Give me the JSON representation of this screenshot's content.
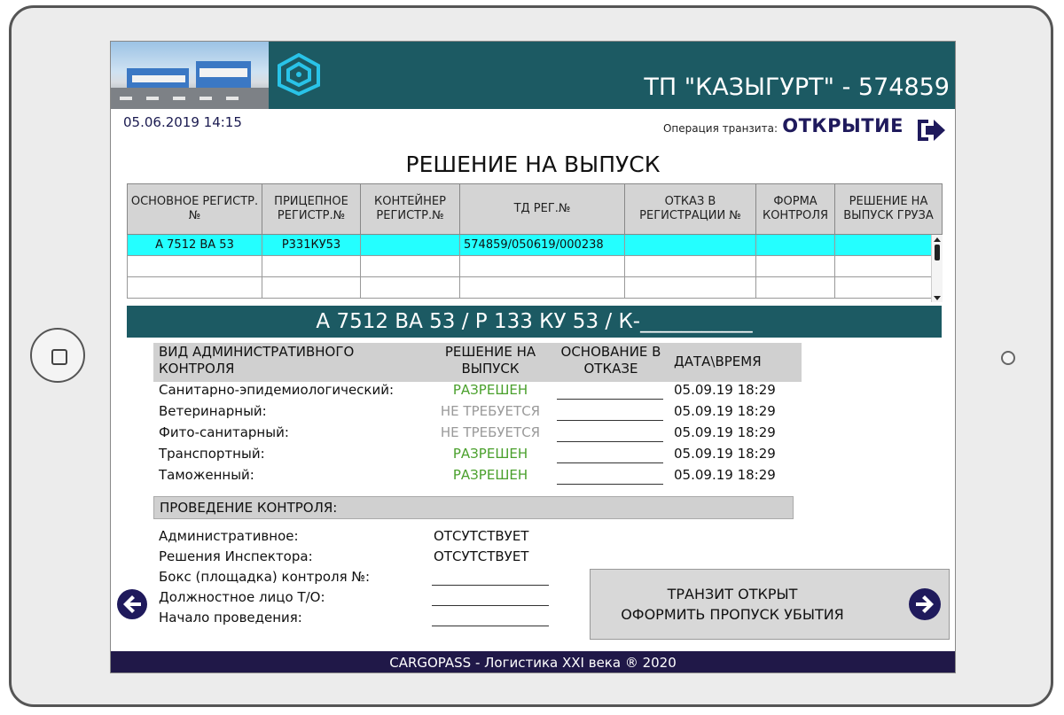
{
  "header": {
    "title": "ТП \"КАЗЫГУРТ\" - 574859"
  },
  "datetime": "05.06.2019 14:15",
  "operation": {
    "label": "Операция транзита:",
    "value": "ОТКРЫТИЕ"
  },
  "main_title": "РЕШЕНИЕ НА ВЫПУСК",
  "table": {
    "columns": [
      "ОСНОВНОЕ РЕГИСТР.№",
      "ПРИЦЕПНОЕ РЕГИСТР.№",
      "КОНТЕЙНЕР РЕГИСТР.№",
      "ТД РЕГ.№",
      "ОТКАЗ В РЕГИСТРАЦИИ №",
      "ФОРМА КОНТРОЛЯ",
      "РЕШЕНИЕ НА ВЫПУСК ГРУЗА"
    ],
    "rows": [
      [
        "А 7512 ВА 53",
        "Р331КУ53",
        "",
        "574859/050619/000238",
        "",
        "",
        ""
      ],
      [
        "",
        "",
        "",
        "",
        "",
        "",
        ""
      ],
      [
        "",
        "",
        "",
        "",
        "",
        "",
        ""
      ]
    ]
  },
  "plate_bar": "А 7512 ВА 53 / Р 133 КУ 53 / К-___________",
  "control": {
    "headers": {
      "type": "ВИД АДМИНИСТРАТИВНОГО КОНТРОЛЯ",
      "decision": "РЕШЕНИЕ НА ВЫПУСК",
      "reason": "ОСНОВАНИЕ В ОТКАЗЕ",
      "datetime": "ДАТА\\ВРЕМЯ"
    },
    "rows": [
      {
        "label": "Санитарно-эпидемиологический:",
        "decision": "РАЗРЕШЕН",
        "status": "ok",
        "datetime": "05.09.19 18:29"
      },
      {
        "label": "Ветеринарный:",
        "decision": "НЕ ТРЕБУЕТСЯ",
        "status": "na",
        "datetime": "05.09.19 18:29"
      },
      {
        "label": "Фито-санитарный:",
        "decision": "НЕ ТРЕБУЕТСЯ",
        "status": "na",
        "datetime": "05.09.19 18:29"
      },
      {
        "label": "Транспортный:",
        "decision": "РАЗРЕШЕН",
        "status": "ok",
        "datetime": "05.09.19 18:29"
      },
      {
        "label": "Таможенный:",
        "decision": "РАЗРЕШЕН",
        "status": "ok",
        "datetime": "05.09.19 18:29"
      }
    ]
  },
  "conduct": {
    "title": "ПРОВЕДЕНИЕ КОНТРОЛЯ:",
    "items": [
      {
        "label": "Административное:",
        "value": "ОТСУТСТВУЕТ"
      },
      {
        "label": "Решения Инспектора:",
        "value": "ОТСУТСТВУЕТ"
      },
      {
        "label": "Бокс (площадка) контроля №:",
        "value": ""
      },
      {
        "label": "Должностное лицо Т/О:",
        "value": ""
      },
      {
        "label": "Начало проведения:",
        "value": ""
      }
    ]
  },
  "action_button": {
    "line1": "ТРАНЗИТ ОТКРЫТ",
    "line2": "ОФОРМИТЬ ПРОПУСК УБЫТИЯ"
  },
  "footer": "CARGOPASS - Логистика XXI века ® 2020",
  "colors": {
    "header_bg": "#1c5a63",
    "footer_bg": "#201848",
    "selected_row": "#24ffff",
    "allowed": "#4aa02c",
    "not_required": "#9a9a9a",
    "icon": "#1f1a5c"
  }
}
